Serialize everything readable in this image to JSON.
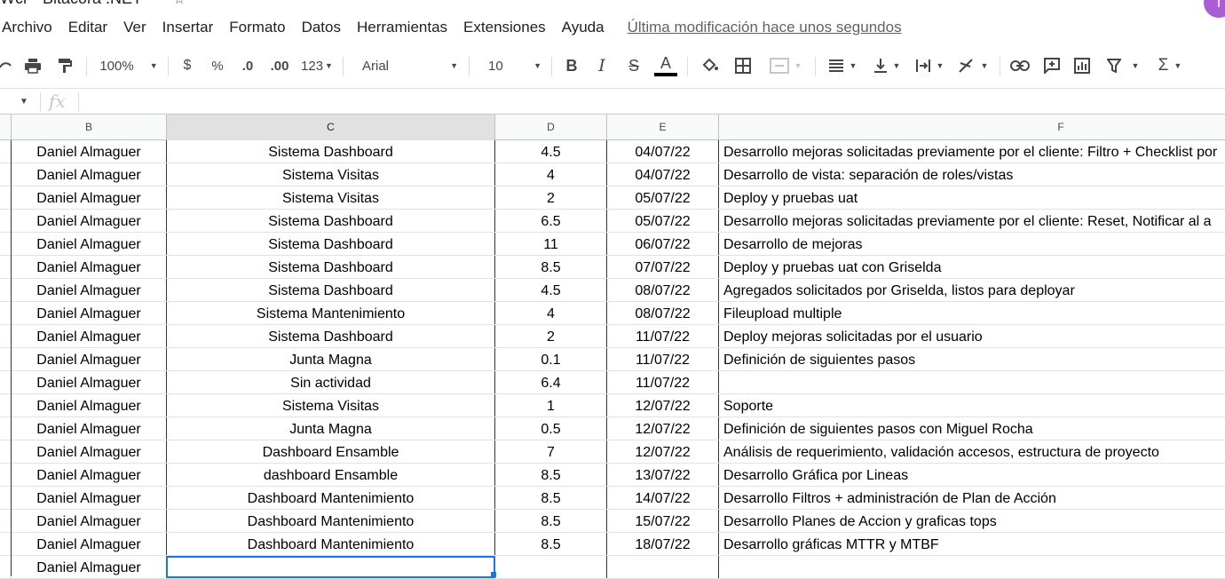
{
  "doc": {
    "title": "Wcr - Bitácora .NET",
    "avatar_letter": "i"
  },
  "menu": {
    "items": [
      "Archivo",
      "Editar",
      "Ver",
      "Insertar",
      "Formato",
      "Datos",
      "Herramientas",
      "Extensiones",
      "Ayuda"
    ],
    "last_edit": "Última modificación hace unos segundos"
  },
  "toolbar": {
    "zoom": "100%",
    "currency": "$",
    "percent": "%",
    "dec_decrease": ".0",
    "dec_increase": ".00",
    "more_formats": "123",
    "font": "Arial",
    "font_size": "10",
    "bold": "B",
    "italic": "I",
    "strike": "S",
    "text_color": "A",
    "sum": "Σ",
    "text_color_value": "#000000"
  },
  "formula_bar": {
    "fx": "fx"
  },
  "columns": [
    "B",
    "C",
    "D",
    "E",
    "F"
  ],
  "selected_column": "C",
  "rows": [
    {
      "B": "Daniel Almaguer",
      "C": "Sistema Dashboard",
      "D": "4.5",
      "E": "04/07/22",
      "F": "Desarrollo mejoras solicitadas previamente por el cliente: Filtro + Checklist por"
    },
    {
      "B": "Daniel Almaguer",
      "C": "Sistema Visitas",
      "D": "4",
      "E": "04/07/22",
      "F": "Desarrollo de vista: separación de roles/vistas"
    },
    {
      "B": "Daniel Almaguer",
      "C": "Sistema Visitas",
      "D": "2",
      "E": "05/07/22",
      "F": "Deploy y pruebas uat"
    },
    {
      "B": "Daniel Almaguer",
      "C": "Sistema Dashboard",
      "D": "6.5",
      "E": "05/07/22",
      "F": "Desarrollo mejoras solicitadas previamente por el cliente: Reset, Notificar al a"
    },
    {
      "B": "Daniel Almaguer",
      "C": "Sistema Dashboard",
      "D": "11",
      "E": "06/07/22",
      "F": "Desarrollo de mejoras"
    },
    {
      "B": "Daniel Almaguer",
      "C": "Sistema Dashboard",
      "D": "8.5",
      "E": "07/07/22",
      "F": "Deploy y pruebas uat con Griselda"
    },
    {
      "B": "Daniel Almaguer",
      "C": "Sistema Dashboard",
      "D": "4.5",
      "E": "08/07/22",
      "F": "Agregados solicitados por Griselda, listos para deployar"
    },
    {
      "B": "Daniel Almaguer",
      "C": "Sistema Mantenimiento",
      "D": "4",
      "E": "08/07/22",
      "F": "Fileupload multiple"
    },
    {
      "B": "Daniel Almaguer",
      "C": "Sistema Dashboard",
      "D": "2",
      "E": "11/07/22",
      "F": "Deploy mejoras solicitadas por el usuario"
    },
    {
      "B": "Daniel Almaguer",
      "C": "Junta Magna",
      "D": "0.1",
      "E": "11/07/22",
      "F": "Definición de siguientes pasos"
    },
    {
      "B": "Daniel Almaguer",
      "C": "Sin actividad",
      "D": "6.4",
      "E": "11/07/22",
      "F": ""
    },
    {
      "B": "Daniel Almaguer",
      "C": "Sistema Visitas",
      "D": "1",
      "E": "12/07/22",
      "F": "Soporte"
    },
    {
      "B": "Daniel Almaguer",
      "C": "Junta Magna",
      "D": "0.5",
      "E": "12/07/22",
      "F": "Definición de siguientes pasos con Miguel Rocha"
    },
    {
      "B": "Daniel Almaguer",
      "C": "Dashboard Ensamble",
      "D": "7",
      "E": "12/07/22",
      "F": "Análisis de requerimiento, validación accesos,  estructura de proyecto"
    },
    {
      "B": "Daniel Almaguer",
      "C": "dashboard Ensamble",
      "D": "8.5",
      "E": "13/07/22",
      "F": "Desarrollo Gráfica por Lineas"
    },
    {
      "B": "Daniel Almaguer",
      "C": "Dashboard Mantenimiento",
      "D": "8.5",
      "E": "14/07/22",
      "F": "Desarrollo Filtros + administración de Plan de Acción"
    },
    {
      "B": "Daniel Almaguer",
      "C": "Dashboard Mantenimiento",
      "D": "8.5",
      "E": "15/07/22",
      "F": "Desarrollo Planes de Accion y graficas tops"
    },
    {
      "B": "Daniel Almaguer",
      "C": "Dashboard Mantenimiento",
      "D": "8.5",
      "E": "18/07/22",
      "F": "Desarrollo gráficas MTTR y MTBF"
    },
    {
      "B": "Daniel Almaguer",
      "C": "",
      "D": "",
      "E": "",
      "F": ""
    }
  ]
}
